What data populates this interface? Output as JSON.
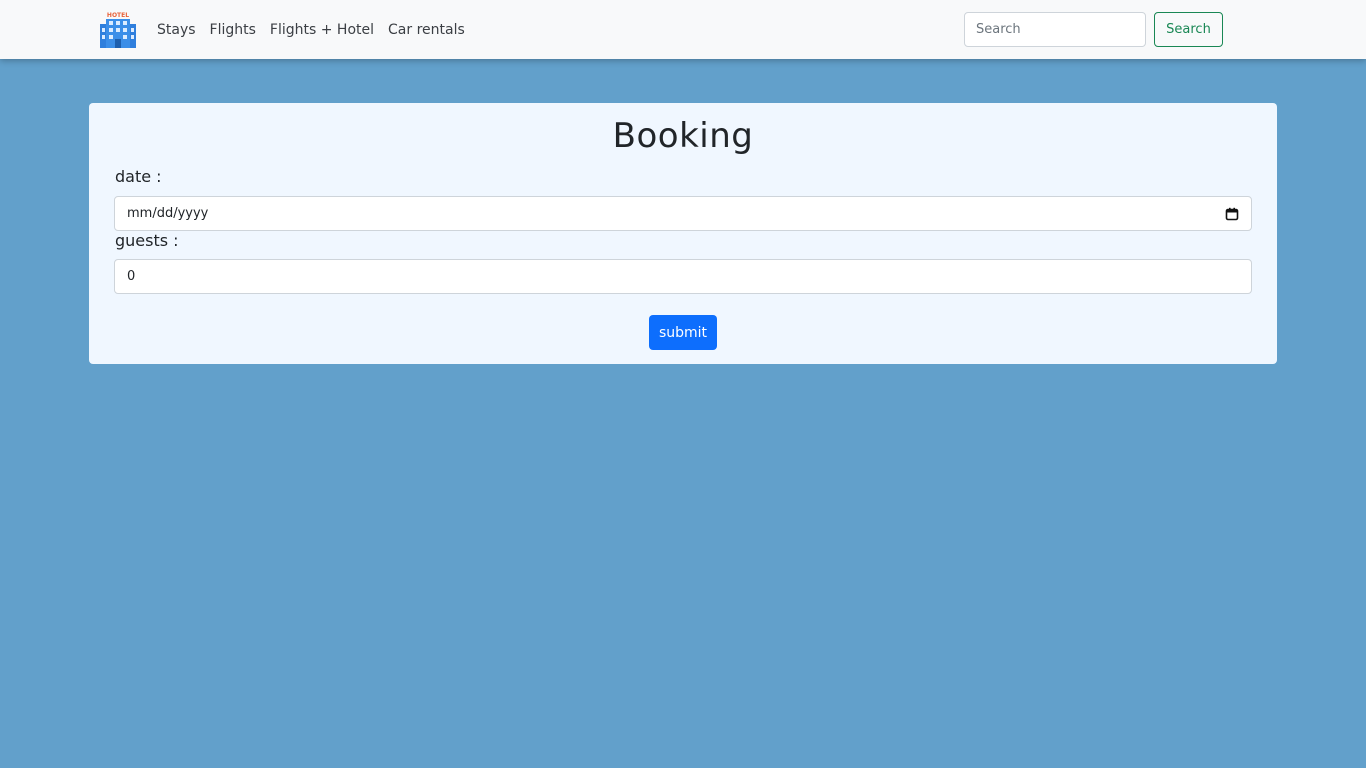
{
  "nav": {
    "logo_icon": "hotel-building-icon",
    "logo_text": "HOTEL",
    "links": [
      "Stays",
      "Flights",
      "Flights + Hotel",
      "Car rentals"
    ],
    "search_placeholder": "Search",
    "search_button": "Search"
  },
  "booking": {
    "title": "Booking",
    "date_label": "date :",
    "date_placeholder": "mm/dd/yyyy",
    "date_icon": "calendar-icon",
    "guests_label": "guests :",
    "guests_value": "0",
    "submit_label": "submit"
  },
  "colors": {
    "page_background": "#62a0cb",
    "navbar_background": "#f8f9fa",
    "card_background": "#f0f7ff",
    "search_button_accent": "#198754",
    "submit_button": "#0d6efd",
    "logo_sign": "#e8633a",
    "logo_building": "#2f7fdd"
  }
}
